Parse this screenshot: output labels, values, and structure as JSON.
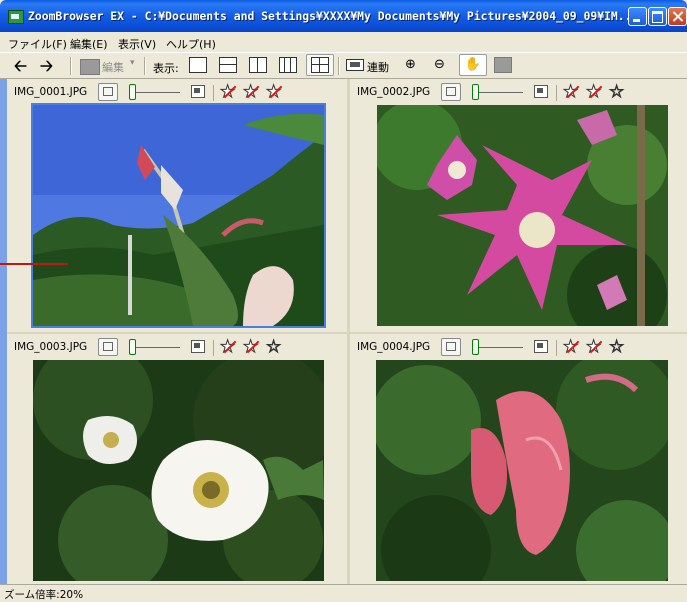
{
  "window": {
    "title": "ZoomBrowser EX - C:¥Documents and Settings¥XXXX¥My Documents¥My Pictures¥2004_09_09¥IM..."
  },
  "menu": {
    "file": "ファイル(F)",
    "edit": "編集(E)",
    "view": "表示(V)",
    "help": "ヘルプ(H)"
  },
  "toolbar": {
    "edit_label": "編集",
    "view_label": "表示:",
    "sync_label": "連動"
  },
  "panels": [
    {
      "filename": "IMG_0001.JPG",
      "rating": 3,
      "marked_count": 3,
      "selected": true
    },
    {
      "filename": "IMG_0002.JPG",
      "rating": 3,
      "marked_count": 2,
      "selected": false
    },
    {
      "filename": "IMG_0003.JPG",
      "rating": 3,
      "marked_count": 2,
      "selected": false
    },
    {
      "filename": "IMG_0004.JPG",
      "rating": 3,
      "marked_count": 2,
      "selected": false
    }
  ],
  "status": {
    "zoom": "ズーム倍率:20%"
  }
}
